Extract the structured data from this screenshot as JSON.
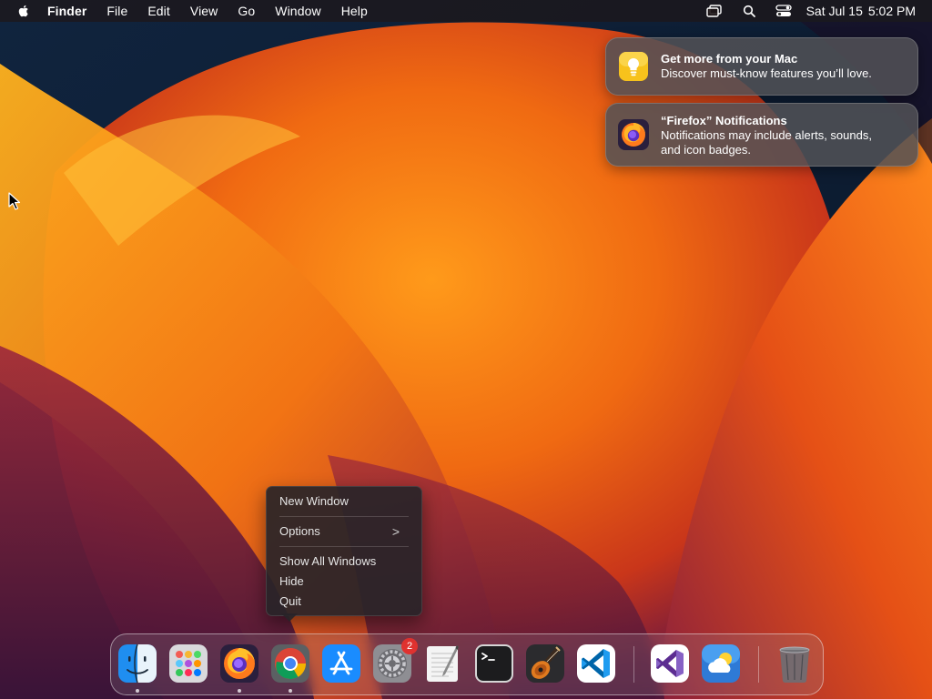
{
  "menubar": {
    "apple_icon": "apple-icon",
    "items": [
      "Finder",
      "File",
      "Edit",
      "View",
      "Go",
      "Window",
      "Help"
    ],
    "status_icons": [
      "screen-mirroring-icon",
      "spotlight-search-icon",
      "control-center-icon"
    ],
    "date": "Sat Jul 15",
    "time": "5:02 PM"
  },
  "notifications": [
    {
      "icon": "tips-lightbulb-icon",
      "title": "Get more from your Mac",
      "body": "Discover must-know features you’ll love."
    },
    {
      "icon": "firefox-icon",
      "title": "“Firefox” Notifications",
      "body_line1": "Notifications may include alerts, sounds,",
      "body_line2": "and icon badges."
    }
  ],
  "context_menu": {
    "new_window": "New Window",
    "options": "Options",
    "options_chevron": ">",
    "show_all_windows": "Show All Windows",
    "hide": "Hide",
    "quit": "Quit"
  },
  "dock": {
    "apps": [
      {
        "name": "Finder",
        "icon": "finder-icon",
        "running": true
      },
      {
        "name": "Launchpad",
        "icon": "launchpad-icon",
        "running": false
      },
      {
        "name": "Firefox",
        "icon": "firefox-icon",
        "running": true
      },
      {
        "name": "Google Chrome",
        "icon": "chrome-icon",
        "running": true
      },
      {
        "name": "App Store",
        "icon": "app-store-icon",
        "running": false
      },
      {
        "name": "System Settings",
        "icon": "system-settings-icon",
        "running": false,
        "badge": "2"
      },
      {
        "name": "TextEdit",
        "icon": "textedit-icon",
        "running": false
      },
      {
        "name": "Terminal",
        "icon": "terminal-icon",
        "running": false
      },
      {
        "name": "GarageBand",
        "icon": "garageband-icon",
        "running": false
      },
      {
        "name": "Visual Studio Code",
        "icon": "vscode-icon",
        "running": false
      },
      {
        "name": "Visual Studio",
        "icon": "visual-studio-icon",
        "running": false
      },
      {
        "name": "Weather",
        "icon": "weather-icon",
        "running": false
      },
      {
        "name": "Trash",
        "icon": "trash-icon",
        "running": false
      }
    ]
  },
  "colors": {
    "wallpaper_orange": "#f07a10",
    "wallpaper_red": "#c8381a",
    "wallpaper_purple": "#6a1d4a",
    "wallpaper_navy": "#0b1e36",
    "badge_red": "#e0322f"
  }
}
